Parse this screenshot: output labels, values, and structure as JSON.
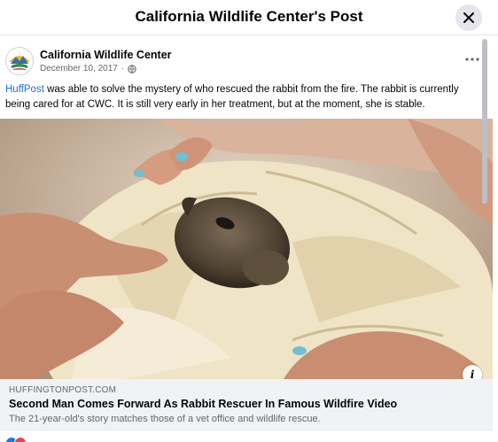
{
  "dialog": {
    "title": "California Wildlife Center's Post",
    "close_icon": "close-icon"
  },
  "post": {
    "page_name": "California Wildlife Center",
    "date": "December 10, 2017",
    "separator": "·",
    "audience_icon": "globe-icon",
    "more_icon": "more-horizontal-icon",
    "text_link": "HuffPost",
    "text_body": " was able to solve the mystery of who rescued the rabbit from the fire. The rabbit is currently being cared for at CWC. It is still very early in her treatment, but at the moment, she is stable."
  },
  "link_preview": {
    "domain": "HUFFINGTONPOST.COM",
    "title": "Second Man Comes Forward As Rabbit Rescuer In Famous Wildfire Video",
    "description": "The 21-year-old's story matches those of a vet office and wildlife rescue.",
    "info_icon": "info-icon"
  },
  "colors": {
    "link": "#216fdb",
    "secondary_text": "#65676b",
    "card_background": "#f0f2f5",
    "like": "#1877f2",
    "love": "#f33e58"
  }
}
